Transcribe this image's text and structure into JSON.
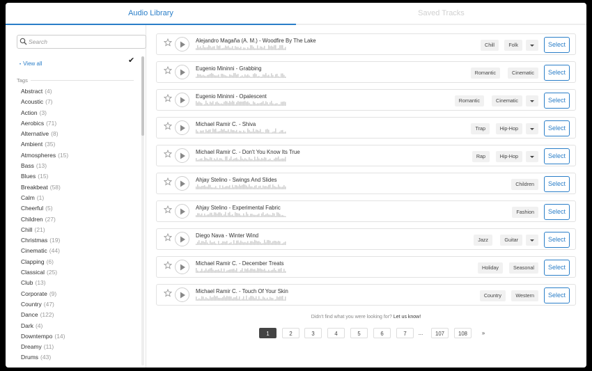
{
  "tabs": {
    "library": "Audio Library",
    "saved": "Saved Tracks"
  },
  "search": {
    "placeholder": "Search"
  },
  "sidebar": {
    "view_all": "View all",
    "tags_heading": "Tags",
    "tags": [
      {
        "name": "Abstract",
        "count": "(4)"
      },
      {
        "name": "Acoustic",
        "count": "(7)"
      },
      {
        "name": "Action",
        "count": "(3)"
      },
      {
        "name": "Aerobics",
        "count": "(71)"
      },
      {
        "name": "Alternative",
        "count": "(8)"
      },
      {
        "name": "Ambient",
        "count": "(35)"
      },
      {
        "name": "Atmospheres",
        "count": "(15)"
      },
      {
        "name": "Bass",
        "count": "(13)"
      },
      {
        "name": "Blues",
        "count": "(15)"
      },
      {
        "name": "Breakbeat",
        "count": "(58)"
      },
      {
        "name": "Calm",
        "count": "(1)"
      },
      {
        "name": "Cheerful",
        "count": "(5)"
      },
      {
        "name": "Children",
        "count": "(27)"
      },
      {
        "name": "Chill",
        "count": "(21)"
      },
      {
        "name": "Christmas",
        "count": "(19)"
      },
      {
        "name": "Cinematic",
        "count": "(44)"
      },
      {
        "name": "Clapping",
        "count": "(6)"
      },
      {
        "name": "Classical",
        "count": "(25)"
      },
      {
        "name": "Club",
        "count": "(13)"
      },
      {
        "name": "Corporate",
        "count": "(9)"
      },
      {
        "name": "Country",
        "count": "(47)"
      },
      {
        "name": "Dance",
        "count": "(122)"
      },
      {
        "name": "Dark",
        "count": "(4)"
      },
      {
        "name": "Downtempo",
        "count": "(14)"
      },
      {
        "name": "Dreamy",
        "count": "(11)"
      },
      {
        "name": "Drums",
        "count": "(43)"
      }
    ]
  },
  "tracks": [
    {
      "title": "Alejandro Magaña (A. M.) - Woodfire By The Lake",
      "tags": [
        "Chill",
        "Folk"
      ],
      "more": true
    },
    {
      "title": "Eugenio Mininni - Grabbing",
      "tags": [
        "Romantic",
        "Cinematic"
      ],
      "more": false
    },
    {
      "title": "Eugenio Mininni - Opalescent",
      "tags": [
        "Romantic",
        "Cinematic"
      ],
      "more": true
    },
    {
      "title": "Michael Ramir C. - Shiva",
      "tags": [
        "Trap",
        "Hip-Hop"
      ],
      "more": true
    },
    {
      "title": "Michael Ramir C. - Don't You Know Its True",
      "tags": [
        "Rap",
        "Hip-Hop"
      ],
      "more": true
    },
    {
      "title": "Ahjay Stelino - Swings And Slides",
      "tags": [
        "Children"
      ],
      "more": false
    },
    {
      "title": "Ahjay Stelino - Experimental Fabric",
      "tags": [
        "Fashion"
      ],
      "more": false
    },
    {
      "title": "Diego Nava - Winter Wind",
      "tags": [
        "Jazz",
        "Guitar"
      ],
      "more": true
    },
    {
      "title": "Michael Ramir C. - December Treats",
      "tags": [
        "Holiday",
        "Seasonal"
      ],
      "more": false
    },
    {
      "title": "Michael Ramir C. - Touch Of Your Skin",
      "tags": [
        "Country",
        "Western"
      ],
      "more": false
    }
  ],
  "select_label": "Select",
  "footer": {
    "question": "Didn't find what you were looking for?",
    "link": "Let us know!"
  },
  "pagination": {
    "pages": [
      "1",
      "2",
      "3",
      "4",
      "5",
      "6",
      "7",
      "...",
      "107",
      "108",
      "»"
    ],
    "current": "1"
  },
  "colors": {
    "accent": "#2a7ec8"
  }
}
